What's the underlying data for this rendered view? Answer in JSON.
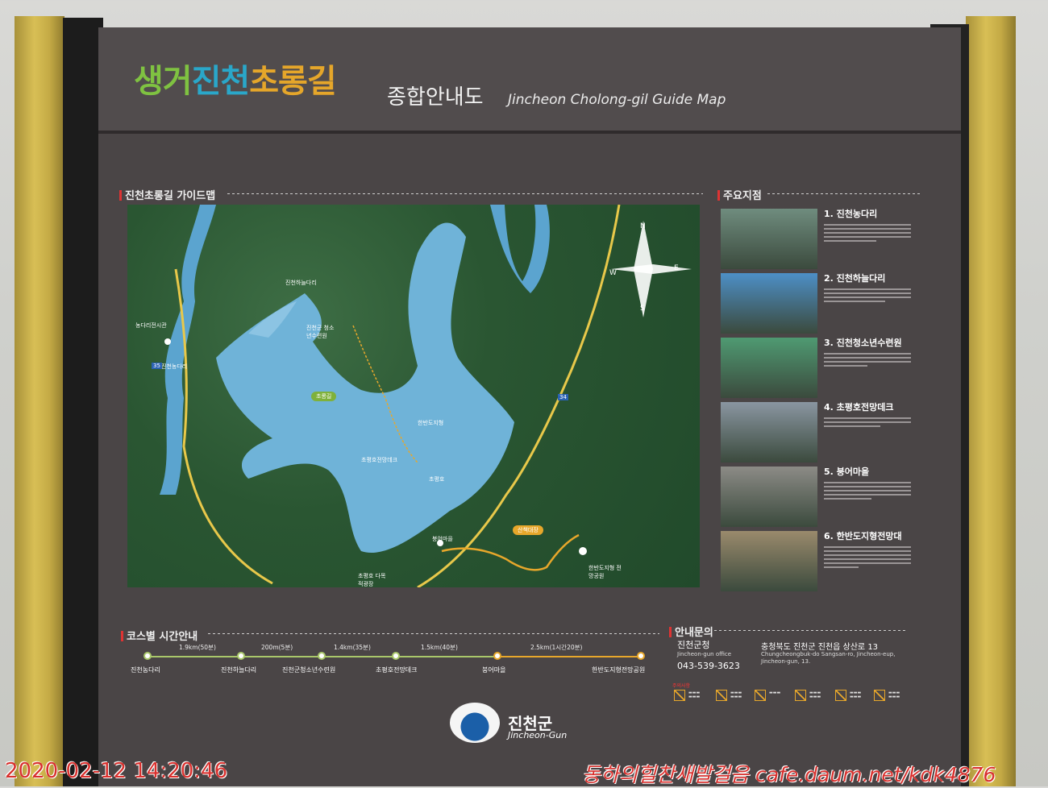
{
  "header": {
    "title_part1": "생거",
    "title_part2": "진천",
    "title_part3": "초롱길",
    "subtitle": "종합안내도",
    "title_en": "Jincheon Cholong-gil Guide Map"
  },
  "map_section": {
    "label": "진천초롱길 가이드맵",
    "labels": {
      "nongdari_museum": "농다리전시관",
      "haneul_bridge": "진천하늘다리",
      "youth_camp": "진천군 청소년수련원",
      "nongdari": "진천농다리",
      "observatory": "초평호전망데크",
      "hanbando": "한반도지형",
      "lake": "초평호",
      "bungeo": "붕어마을",
      "hanbando_park": "한반도지형 전망공원",
      "dahaeng": "초평호 다목적광장",
      "route35": "35",
      "route34": "34",
      "pill1": "초롱길",
      "pill2": "산책대장"
    },
    "compass": {
      "n": "N",
      "e": "E",
      "s": "S",
      "w": "W"
    }
  },
  "spots_section": {
    "label": "주요지점",
    "items": [
      {
        "name": "1. 진천농다리",
        "photo_color": "#6f8c7e"
      },
      {
        "name": "2. 진천하늘다리",
        "photo_color": "#4d8fc6"
      },
      {
        "name": "3. 진천청소년수련원",
        "photo_color": "#4f9a72"
      },
      {
        "name": "4. 초평호전망데크",
        "photo_color": "#8a96a1"
      },
      {
        "name": "5. 붕어마을",
        "photo_color": "#8c8b86"
      },
      {
        "name": "6. 한반도지형전망대",
        "photo_color": "#9a8a6c"
      }
    ]
  },
  "timeline": {
    "label": "코스별 시간안내",
    "stops": [
      "진천농다리",
      "진천하늘다리",
      "진천군청소년수련원",
      "초평호전망데크",
      "붕어마을",
      "한반도지형전망공원"
    ],
    "distances": [
      "1.9km(50분)",
      "200m(5분)",
      "1.4km(35분)",
      "1.5km(40분)",
      "2.5km(1시간20분)"
    ]
  },
  "contact": {
    "label": "안내문의",
    "office": "진천군청",
    "office_en": "Jincheon-gun office",
    "tel": "043-539-3623",
    "address": "충청북도 진천군 진천읍 상산로 13",
    "address_en": "Chungcheongbuk-do Sangsan-ro, Jincheon-eup, Jincheon-gun, 13.",
    "caution_label": "주의사항"
  },
  "logo": {
    "kr": "진천군",
    "en": "Jincheon-Gun"
  },
  "overlay": {
    "timestamp": "2020-02-12  14:20:46",
    "watermark": "동하의힐찬새발걸음 cafe.daum.net/kdk4876"
  },
  "colors": {
    "board": "#4a4546",
    "post": "#d8bf55",
    "lake": "#6fb3d8",
    "forest": "#2a5632",
    "route_green": "#a9c76a",
    "route_orange": "#e7a72b",
    "stamp_red": "#d8302d"
  }
}
